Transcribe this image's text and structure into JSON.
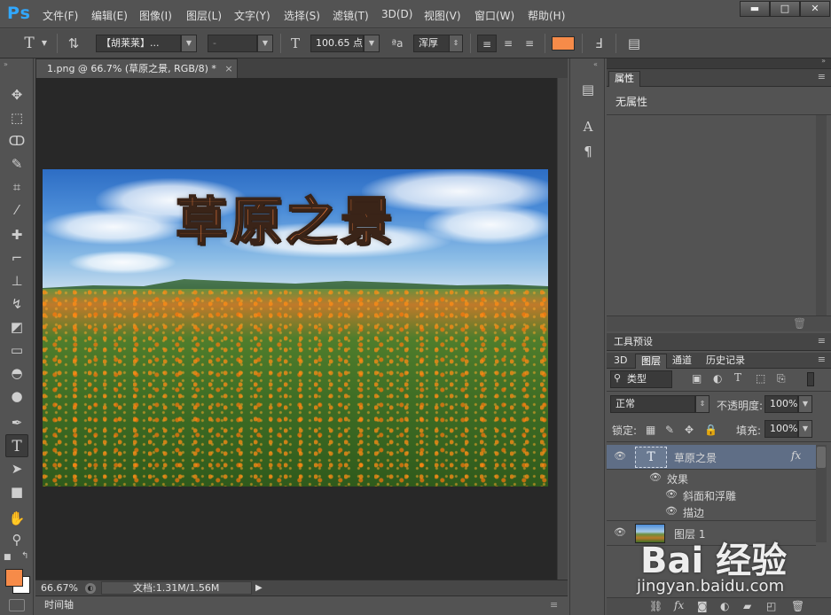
{
  "app": {
    "logo": "Ps"
  },
  "menu": [
    "文件(F)",
    "编辑(E)",
    "图像(I)",
    "图层(L)",
    "文字(Y)",
    "选择(S)",
    "滤镜(T)",
    "3D(D)",
    "视图(V)",
    "窗口(W)",
    "帮助(H)"
  ],
  "window_controls": {
    "minimize": "▬",
    "maximize": "□",
    "close": "✕"
  },
  "options_bar": {
    "tool_glyph": "T",
    "font_family": "【胡莱莱】...",
    "font_style": "-",
    "font_size": "100.65 点",
    "aa_label": "ªa",
    "antialias": "浑厚",
    "text_color": "#f68b49"
  },
  "document": {
    "tab_title": "1.png @ 66.7% (草原之景, RGB/8) *",
    "tab_close": "×",
    "image_text": "草原之景",
    "zoom": "66.67%",
    "doc_info": "文档:1.31M/1.56M",
    "timeline_label": "时间轴"
  },
  "colors": {
    "foreground": "#f68b49",
    "background": "#ffffff",
    "accent": "#31a8ff"
  },
  "properties_panel": {
    "tab": "属性",
    "content": "无属性"
  },
  "tool_presets_panel": {
    "tab": "工具预设"
  },
  "layers_panel": {
    "tabs": [
      "3D",
      "图层",
      "通道",
      "历史记录"
    ],
    "filter_kind": "类型",
    "blend_mode": "正常",
    "opacity_label": "不透明度:",
    "opacity_value": "100%",
    "lock_label": "锁定:",
    "fill_label": "填充:",
    "fill_value": "100%",
    "layers": [
      {
        "name": "草原之景",
        "type_glyph": "T",
        "fx": "fx"
      },
      {
        "name": "效果"
      },
      {
        "name": "斜面和浮雕"
      },
      {
        "name": "描边"
      },
      {
        "name": "图层 1"
      }
    ]
  },
  "watermark": {
    "logo": "Bai 经验",
    "url": "jingyan.baidu.com"
  }
}
